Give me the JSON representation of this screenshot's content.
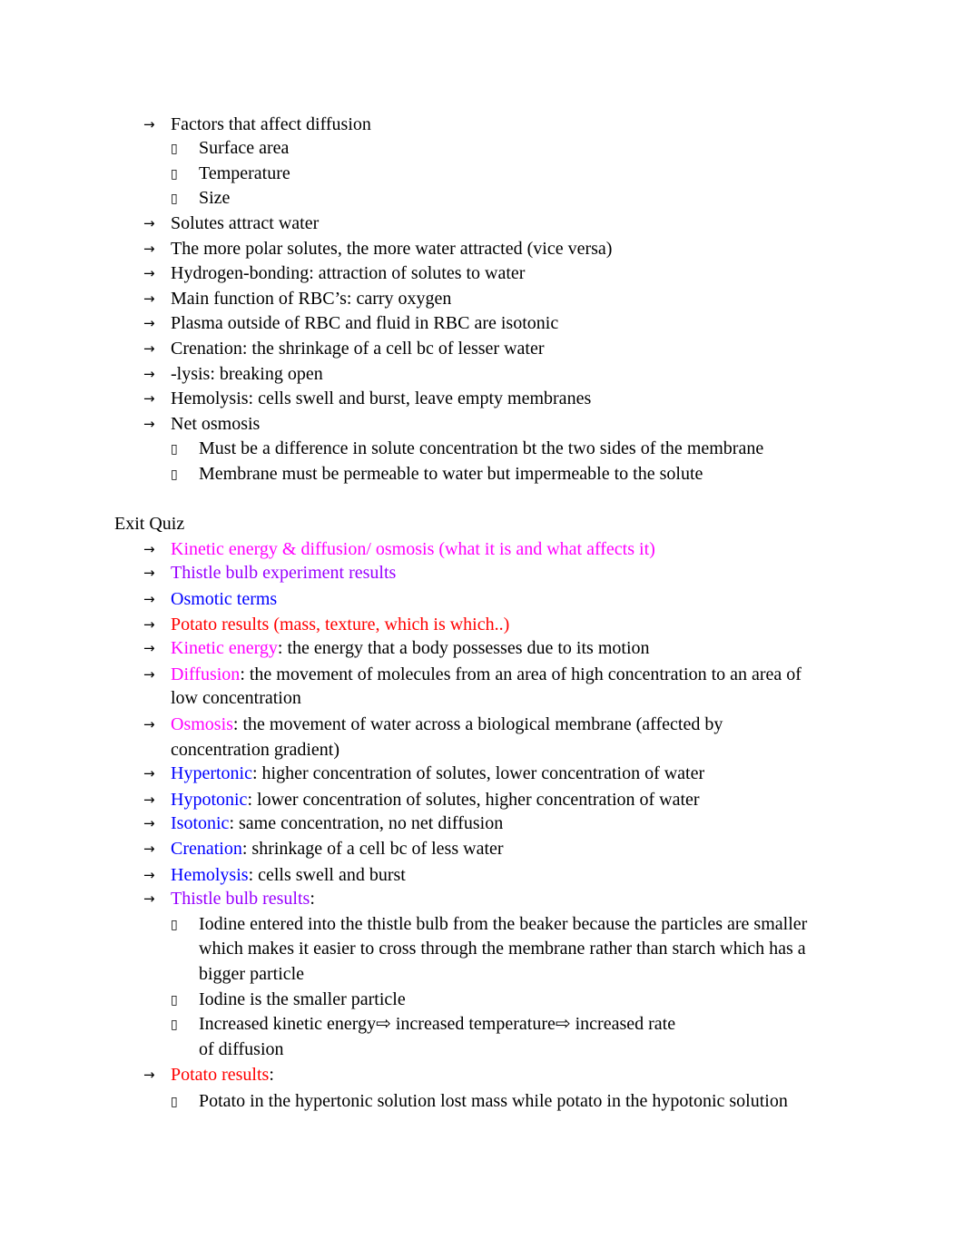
{
  "colors": {
    "magenta": "#ff00ff",
    "purple": "#9900ff",
    "blue": "#0000ff",
    "red": "#ff0000",
    "black": "#000000"
  },
  "icons": {
    "arrow": "→",
    "box": "",
    "implies": "⇨"
  },
  "notes": {
    "factors": "Factors that affect diffusion",
    "factors_sub": [
      "Surface area",
      "Temperature",
      "Size"
    ],
    "items": [
      "Solutes attract water",
      "The more polar solutes, the more water attracted (vice versa)",
      "Hydrogen-bonding: attraction of solutes to water",
      "Main function of RBC’s:  carry oxygen",
      "Plasma outside of RBC and fluid in RBC are isotonic",
      "Crenation: the shrinkage of a cell bc of lesser water",
      "-lysis: breaking open",
      "Hemolysis: cells swell and burst, leave empty membranes",
      "Net osmosis"
    ],
    "net_osmosis_sub": [
      "Must be a difference in solute concentration bt the two sides of the membrane",
      "Membrane must be permeable to water but impermeable to the solute"
    ]
  },
  "exit_quiz": {
    "heading": "Exit Quiz",
    "topics": [
      "Kinetic energy & diffusion/ osmosis (what it is and what affects it)",
      "Thistle bulb experiment results",
      "Osmotic terms",
      "Potato results (mass, texture, which is which..)"
    ],
    "definitions": [
      {
        "term": "Kinetic energy",
        "def": ": the energy that a body possesses due to its motion"
      },
      {
        "term": "Diffusion",
        "def": ": the movement of molecules from an area of high concentration to an area of",
        "cont": "low concentration"
      },
      {
        "term": "Osmosis",
        "def": ": the movement of water across a biological membrane (affected by",
        "cont": "concentration gradient)"
      },
      {
        "term": "Hypertonic",
        "def": ": higher concentration of solutes, lower concentration of water"
      },
      {
        "term": "Hypotonic",
        "def": ": lower concentration of solutes, higher concentration of water"
      },
      {
        "term": "Isotonic",
        "def": ": same concentration, no net diffusion"
      },
      {
        "term": "Crenation",
        "def": ": shrinkage of a cell bc of less water"
      },
      {
        "term": "Hemolysis",
        "def": ": cells swell and burst"
      }
    ],
    "thistle": {
      "label": "Thistle bulb results",
      "colon": ":",
      "sub": [
        [
          "Iodine entered into the thistle bulb from the beaker because the particles are smaller",
          "which makes it easier to cross through the membrane rather than starch which has a",
          "bigger particle"
        ],
        [
          "Iodine is the smaller particle"
        ],
        [
          "Increased kinetic energy⇨ increased temperature⇨ increased rate",
          "of diffusion"
        ]
      ]
    },
    "potato": {
      "label": "Potato results",
      "colon": ":",
      "sub": [
        "Potato in the hypertonic solution lost mass while potato in the hypotonic solution"
      ]
    }
  }
}
